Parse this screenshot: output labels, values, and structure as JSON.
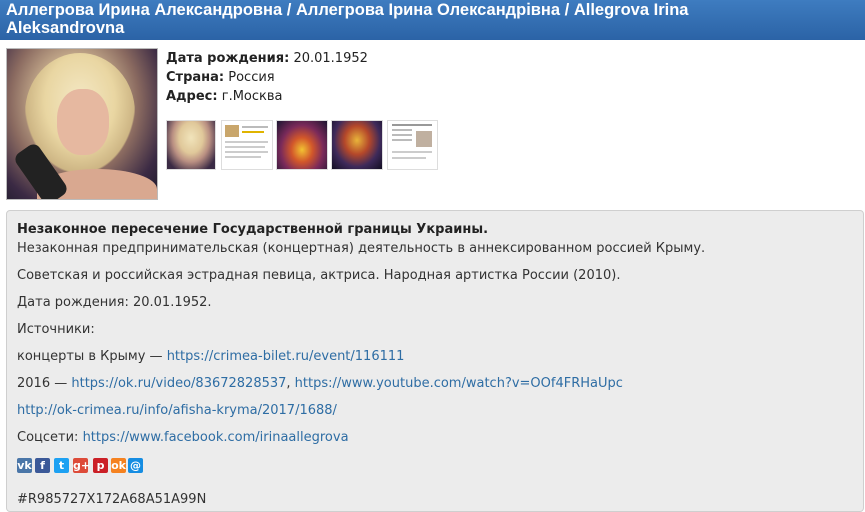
{
  "header": {
    "title": "Аллегрова Ирина Александровна / Аллегрова Ірина Олександрівна / Allegrova Irina Aleksandrovna"
  },
  "profile": {
    "birth_label": "Дата рождения:",
    "birth_value": "20.01.1952",
    "country_label": "Страна:",
    "country_value": "Россия",
    "address_label": "Адрес:",
    "address_value": "г.Москва"
  },
  "thumbnails": [
    {
      "name": "thumbnail-photo-1",
      "desc": "portrait photo"
    },
    {
      "name": "thumbnail-document-1",
      "desc": "webpage screenshot"
    },
    {
      "name": "thumbnail-concert-1",
      "desc": "concert stage"
    },
    {
      "name": "thumbnail-concert-2",
      "desc": "concert stage"
    },
    {
      "name": "thumbnail-document-2",
      "desc": "article screenshot"
    }
  ],
  "details": {
    "heading": "Незаконное пересечение Государственной границы Украины.",
    "line1": "Незаконная предпринимательская (концертная) деятельность в аннексированном россией Крыму.",
    "line2": "Советская и российская эстрадная певица, актриса. Народная артистка России (2010).",
    "line3": "Дата рождения: 20.01.1952.",
    "sources_label": "Источники:",
    "crimea_prefix": "концерты в Крыму — ",
    "crimea_link": "https://crimea-bilet.ru/event/116111",
    "y2016_prefix": "2016 — ",
    "ok_link": "https://ok.ru/video/83672828537",
    "comma": ", ",
    "youtube_link": "https://www.youtube.com/watch?v=OOf4FRHaUpc",
    "afisha_link": "http://ok-crimea.ru/info/afisha-kryma/2017/1688/",
    "social_prefix": "Соцсети: ",
    "facebook_link": "https://www.facebook.com/irinaallegrova",
    "code": "#R985727X172A68A51A99N"
  },
  "social_icons": [
    {
      "name": "vk-icon",
      "glyph": "vk",
      "color": "#4a76a8"
    },
    {
      "name": "facebook-icon",
      "glyph": "f",
      "color": "#3b5998"
    },
    {
      "name": "twitter-icon",
      "glyph": "t",
      "color": "#1da1f2"
    },
    {
      "name": "google-plus-icon",
      "glyph": "g+",
      "color": "#dd4b39"
    },
    {
      "name": "pinterest-icon",
      "glyph": "p",
      "color": "#cb2027"
    },
    {
      "name": "odnoklassniki-icon",
      "glyph": "ok",
      "color": "#f58220"
    },
    {
      "name": "email-icon",
      "glyph": "@",
      "color": "#168de2"
    }
  ]
}
